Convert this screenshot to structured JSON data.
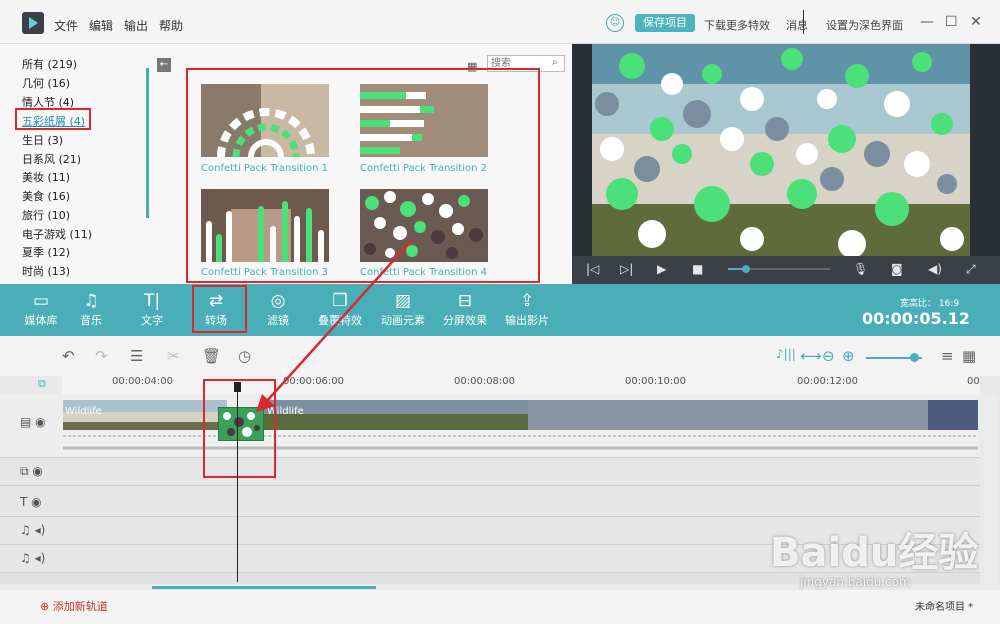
{
  "menu": {
    "file": "文件",
    "edit": "编辑",
    "export": "输出",
    "help": "帮助"
  },
  "header": {
    "save_project": "保存项目",
    "download_effects": "下载更多特效",
    "messages": "消息",
    "dark_theme": "设置为深色界面"
  },
  "categories": [
    {
      "label": "所有 (219)"
    },
    {
      "label": "几何 (16)"
    },
    {
      "label": "情人节 (4)"
    },
    {
      "label": "五彩纸屑 (4)",
      "selected": true
    },
    {
      "label": "生日 (3)"
    },
    {
      "label": "日系风 (21)"
    },
    {
      "label": "美妆 (11)"
    },
    {
      "label": "美食 (16)"
    },
    {
      "label": "旅行 (10)"
    },
    {
      "label": "电子游戏 (11)"
    },
    {
      "label": "夏季 (12)"
    },
    {
      "label": "时尚 (13)"
    }
  ],
  "search": {
    "placeholder": "搜索"
  },
  "transitions": [
    {
      "label": "Confetti Pack Transition 1"
    },
    {
      "label": "Confetti Pack Transition 2"
    },
    {
      "label": "Confetti Pack Transition 3"
    },
    {
      "label": "Confetti Pack Transition 4"
    }
  ],
  "toolbar": {
    "media": "媒体库",
    "music": "音乐",
    "text": "文字",
    "transition": "转场",
    "filter": "滤镜",
    "overlay": "叠覆特效",
    "elements": "动画元素",
    "split": "分屏效果",
    "export": "输出影片"
  },
  "aspect": {
    "label": "宽高比：",
    "value": "16:9"
  },
  "timecode": "00:00:05.12",
  "ruler": [
    "00:00:04:00",
    "00:00:06:00",
    "00:00:08:00",
    "00:00:10:00",
    "00:00:12:00",
    "00"
  ],
  "clips": {
    "clip1": "Wildlife",
    "clip2": "Wildlife"
  },
  "footer": {
    "add_track": "添加新轨道",
    "project_name": "未命名项目 *"
  },
  "watermark": {
    "main": "Baidu经验",
    "sub": "jingyan.baidu.com"
  },
  "colors": {
    "accent": "#4aaeb8",
    "highlight": "#d8292f",
    "confetti_green": "#4be07a"
  }
}
